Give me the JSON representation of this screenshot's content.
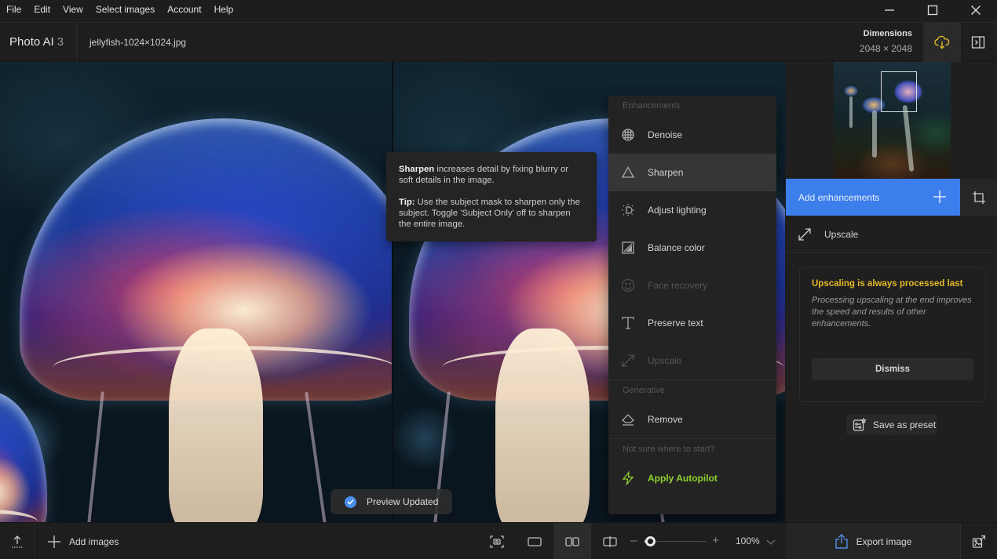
{
  "menubar": {
    "items": [
      "File",
      "Edit",
      "View",
      "Select images",
      "Account",
      "Help"
    ]
  },
  "window_controls": {
    "minimize": "minimize-icon",
    "maximize": "maximize-icon",
    "close": "close-icon"
  },
  "header": {
    "app_name": "Photo AI",
    "app_version": "3",
    "file_name": "jellyfish-1024×1024.jpg",
    "dimensions_label": "Dimensions",
    "dimensions_value": "2048 × 2048",
    "cloud_icon": "cloud-download-icon",
    "panel_icon": "toggle-panel-icon"
  },
  "tooltip": {
    "title": "Sharpen",
    "description": " increases detail by fixing blurry or soft details in the image.",
    "tip_label": "Tip:",
    "tip_text": " Use the subject mask to sharpen only the subject. Toggle 'Subject Only' off to sharpen the entire image."
  },
  "dropdown": {
    "sections": [
      {
        "title": "Enhancements",
        "items": [
          {
            "label": "Denoise",
            "icon": "globe-grid-icon",
            "state": "normal"
          },
          {
            "label": "Sharpen",
            "icon": "triangle-icon",
            "state": "active"
          },
          {
            "label": "Adjust lighting",
            "icon": "light-bulb-icon",
            "state": "normal"
          },
          {
            "label": "Balance color",
            "icon": "balance-color-icon",
            "state": "normal"
          },
          {
            "label": "Face recovery",
            "icon": "smiley-icon",
            "state": "disabled"
          },
          {
            "label": "Preserve text",
            "icon": "text-t-icon",
            "state": "normal"
          },
          {
            "label": "Upscale",
            "icon": "expand-arrows-icon",
            "state": "disabled"
          }
        ]
      },
      {
        "title": "Generative",
        "items": [
          {
            "label": "Remove",
            "icon": "eraser-icon",
            "state": "normal"
          }
        ]
      },
      {
        "title": "Not sure where to start?",
        "items": [
          {
            "label": "Apply Autopilot",
            "icon": "lightning-icon",
            "state": "highlight"
          }
        ]
      }
    ]
  },
  "sidepanel": {
    "add_enhancements_label": "Add enhancements",
    "upscale_label": "Upscale",
    "notice": {
      "title": "Upscaling is always processed last",
      "body": "Processing upscaling at the end improves the speed and results of other enhancements.",
      "dismiss_label": "Dismiss"
    },
    "save_preset_label": "Save as preset"
  },
  "toast": {
    "message": "Preview Updated"
  },
  "bottombar": {
    "add_images_label": "Add images",
    "zoom_percent": "100%",
    "zoom_slider_fraction": 0.1,
    "view_modes": [
      "snapshot",
      "single",
      "side-by-side",
      "split"
    ],
    "active_view_mode": "side-by-side",
    "export_label": "Export image"
  },
  "colors": {
    "accent_blue": "#3b7eec",
    "notice_yellow": "#e3b925",
    "autopilot_green": "#8fd12f",
    "cloud_icon_yellow": "#e0b82a"
  }
}
